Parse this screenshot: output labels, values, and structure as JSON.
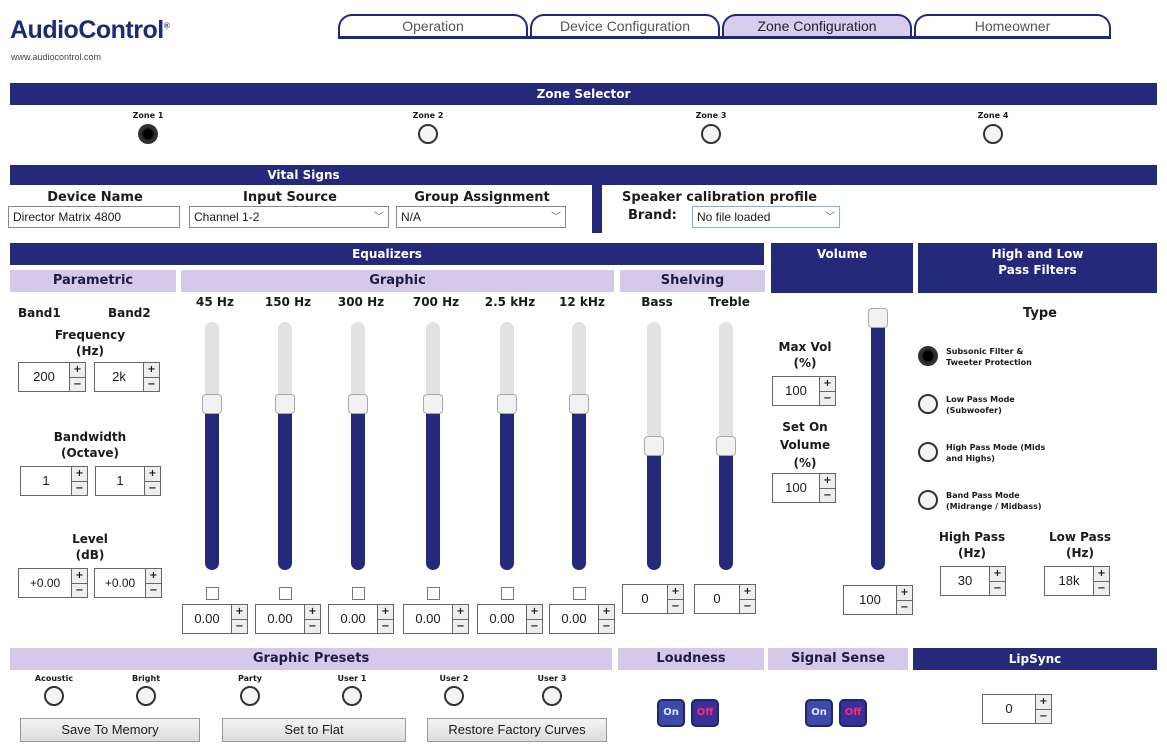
{
  "brand": {
    "name": "AudioControl",
    "url": "www.audiocontrol.com"
  },
  "tabs": [
    {
      "label": "Operation",
      "active": false
    },
    {
      "label": "Device Configuration",
      "active": false
    },
    {
      "label": "Zone Configuration",
      "active": true
    },
    {
      "label": "Homeowner",
      "active": false
    }
  ],
  "zone_selector": {
    "title": "Zone Selector",
    "zones": [
      {
        "label": "Zone 1",
        "selected": true
      },
      {
        "label": "Zone 2",
        "selected": false
      },
      {
        "label": "Zone 3",
        "selected": false
      },
      {
        "label": "Zone 4",
        "selected": false
      }
    ]
  },
  "vital_signs": {
    "title": "Vital Signs",
    "device_name_label": "Device Name",
    "device_name_value": "Director Matrix 4800",
    "input_source_label": "Input Source",
    "input_source_value": "Channel 1-2",
    "group_assignment_label": "Group Assignment",
    "group_assignment_value": "N/A",
    "speaker_cal_label": "Speaker calibration profile",
    "brand_label": "Brand:",
    "brand_value": "No file loaded"
  },
  "equalizers": {
    "title": "Equalizers",
    "parametric": {
      "title": "Parametric",
      "band1_label": "Band1",
      "band2_label": "Band2",
      "frequency_label": "Frequency",
      "frequency_unit": "(Hz)",
      "frequency_values": [
        "200",
        "2k"
      ],
      "bandwidth_label": "Bandwidth",
      "bandwidth_unit": "(Octave)",
      "bandwidth_values": [
        "1",
        "1"
      ],
      "level_label": "Level",
      "level_unit": "(dB)",
      "level_values": [
        "+0.00",
        "+0.00"
      ]
    },
    "graphic": {
      "title": "Graphic",
      "bands": [
        {
          "label": "45 Hz",
          "value": "0.00",
          "level": 0.67
        },
        {
          "label": "150 Hz",
          "value": "0.00",
          "level": 0.67
        },
        {
          "label": "300 Hz",
          "value": "0.00",
          "level": 0.67
        },
        {
          "label": "700 Hz",
          "value": "0.00",
          "level": 0.67
        },
        {
          "label": "2.5 kHz",
          "value": "0.00",
          "level": 0.67
        },
        {
          "label": "12 kHz",
          "value": "0.00",
          "level": 0.67
        }
      ]
    },
    "shelving": {
      "title": "Shelving",
      "bands": [
        {
          "label": "Bass",
          "value": "0",
          "level": 0.5
        },
        {
          "label": "Treble",
          "value": "0",
          "level": 0.5
        }
      ]
    }
  },
  "volume": {
    "title": "Volume",
    "max_vol_label": "Max Vol",
    "max_vol_unit": "(%)",
    "max_vol_value": "100",
    "set_on_label": "Set On",
    "set_on_label2": "Volume",
    "set_on_unit": "(%)",
    "set_on_value": "100",
    "slider_value": "100",
    "level": 1.0
  },
  "filters": {
    "title_line1": "High and Low",
    "title_line2": "Pass Filters",
    "type_label": "Type",
    "options": [
      {
        "line1": "Subsonic Filter &",
        "line2": "Tweeter Protection",
        "selected": true
      },
      {
        "line1": "Low Pass Mode",
        "line2": "(Subwoofer)",
        "selected": false
      },
      {
        "line1": "High Pass Mode (Mids",
        "line2": "and Highs)",
        "selected": false
      },
      {
        "line1": "Band Pass Mode",
        "line2": "(Midrange / Midbass)",
        "selected": false
      }
    ],
    "high_pass_label": "High Pass",
    "high_pass_unit": "(Hz)",
    "high_pass_value": "30",
    "low_pass_label": "Low Pass",
    "low_pass_unit": "(Hz)",
    "low_pass_value": "18k"
  },
  "presets": {
    "title": "Graphic Presets",
    "items": [
      "Acoustic",
      "Bright",
      "Party",
      "User 1",
      "User 2",
      "User 3"
    ],
    "save_label": "Save To Memory",
    "flat_label": "Set to Flat",
    "restore_label": "Restore Factory Curves"
  },
  "loudness": {
    "title": "Loudness",
    "on_label": "On",
    "off_label": "Off"
  },
  "signal_sense": {
    "title": "Signal Sense",
    "on_label": "On",
    "off_label": "Off"
  },
  "lipsync": {
    "title": "LipSync",
    "value": "0"
  },
  "colors": {
    "navy": "#25297a",
    "lavender": "#d5c9ea",
    "toggle_off_text": "#ff2a6a"
  }
}
